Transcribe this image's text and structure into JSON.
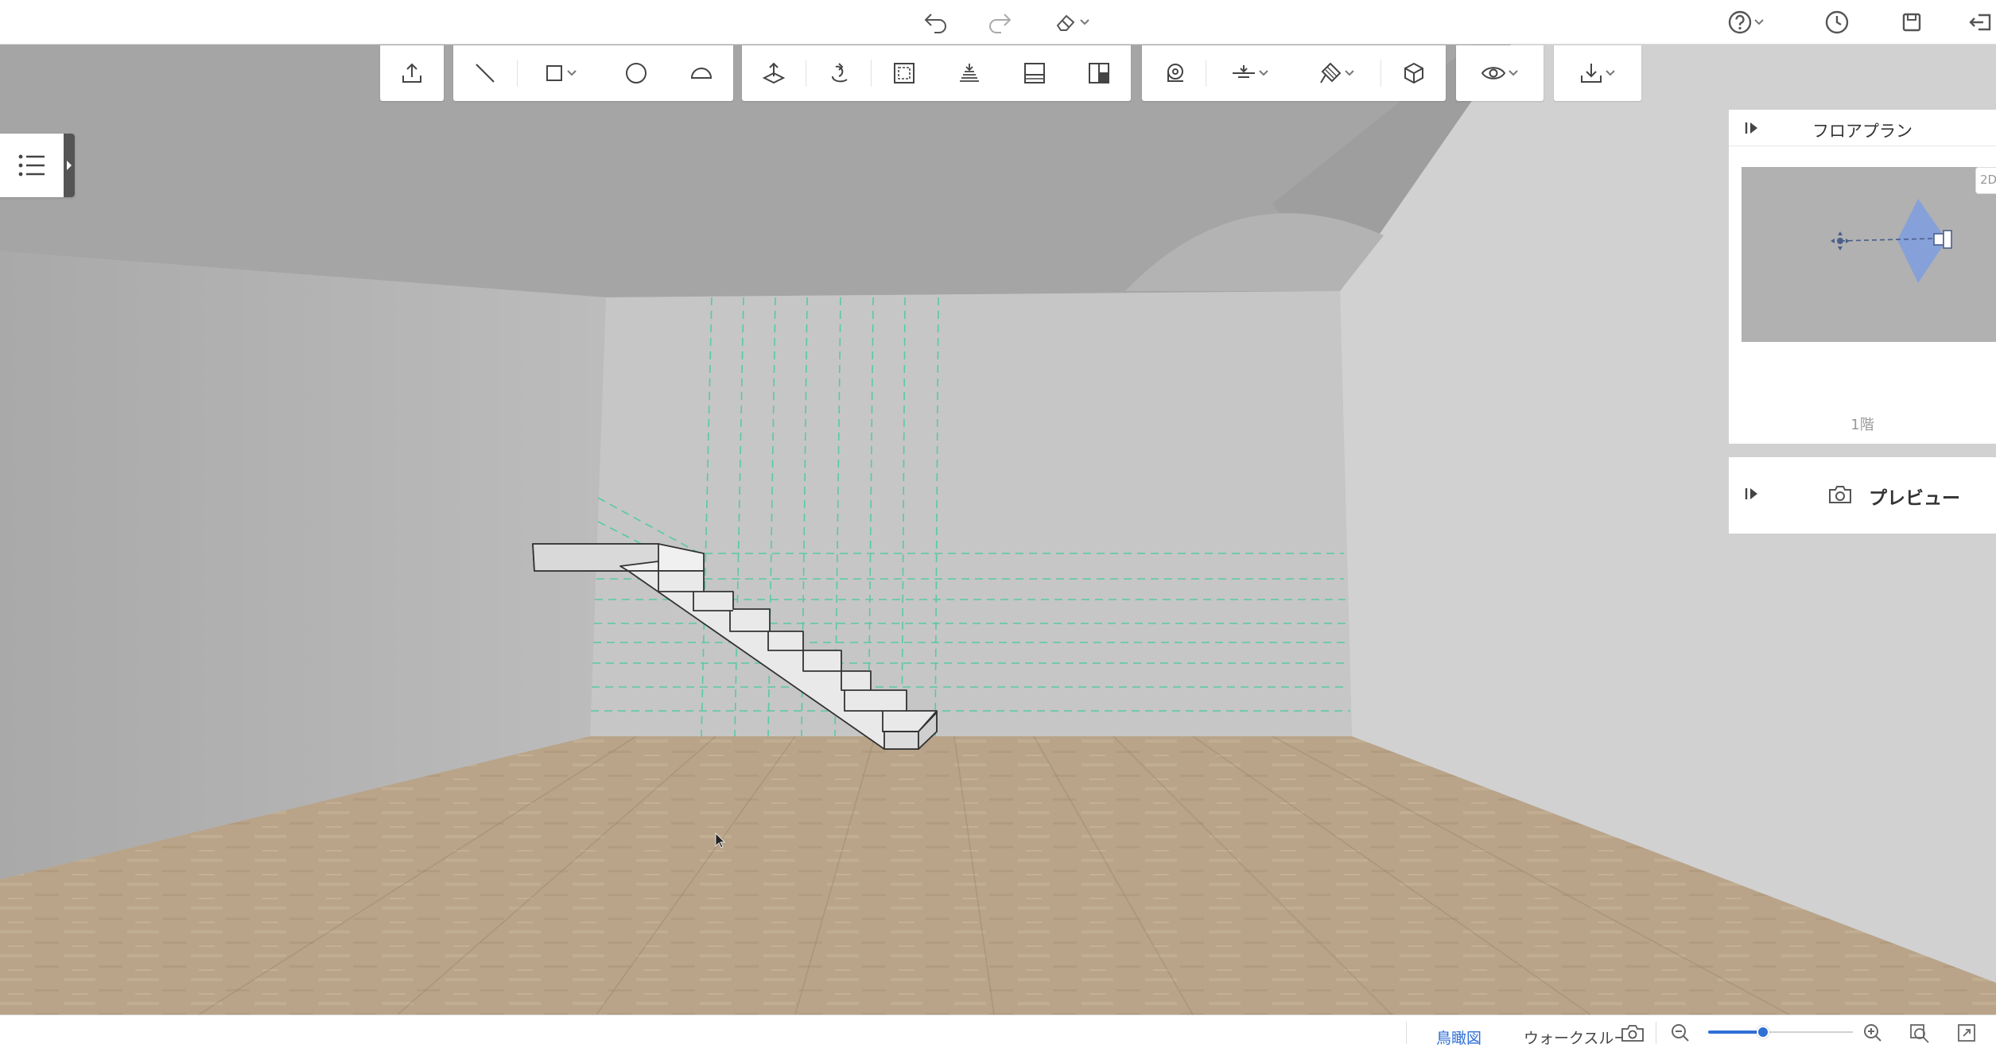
{
  "topbar": {
    "undo_icon": "undo-icon",
    "redo_icon": "redo-icon",
    "eraser_icon": "eraser-icon",
    "help_icon": "help-icon",
    "history_icon": "clock-icon",
    "save_icon": "save-icon",
    "exit_icon": "exit-icon"
  },
  "toolbar": {
    "groups": [
      [
        "upload-icon"
      ],
      [
        "line-icon",
        "rectangle-icon",
        "circle-icon",
        "arc-icon"
      ],
      [
        "push-pull-icon",
        "rotate-icon",
        "offset-icon",
        "stair-icon",
        "panel-icon",
        "split-icon"
      ],
      [
        "measure-icon",
        "align-icon",
        "paint-icon",
        "cube-icon"
      ],
      [
        "eye-icon"
      ],
      [
        "download-icon"
      ]
    ]
  },
  "floor_panel": {
    "title": "フロアプラン",
    "mode_toggle": "2D",
    "floor_label": "1階"
  },
  "preview_panel": {
    "label": "プレビュー"
  },
  "statusbar": {
    "tab_birdseye": "鳥瞰図",
    "tab_walkthrough": "ウォークスルー",
    "zoom_level": 0.38
  },
  "colors": {
    "accent": "#2f6fd6",
    "floor": "#b9a489",
    "wall": "#c6c6c6",
    "guide": "#58c9a6",
    "camera_fov": "#7f9fe0"
  }
}
